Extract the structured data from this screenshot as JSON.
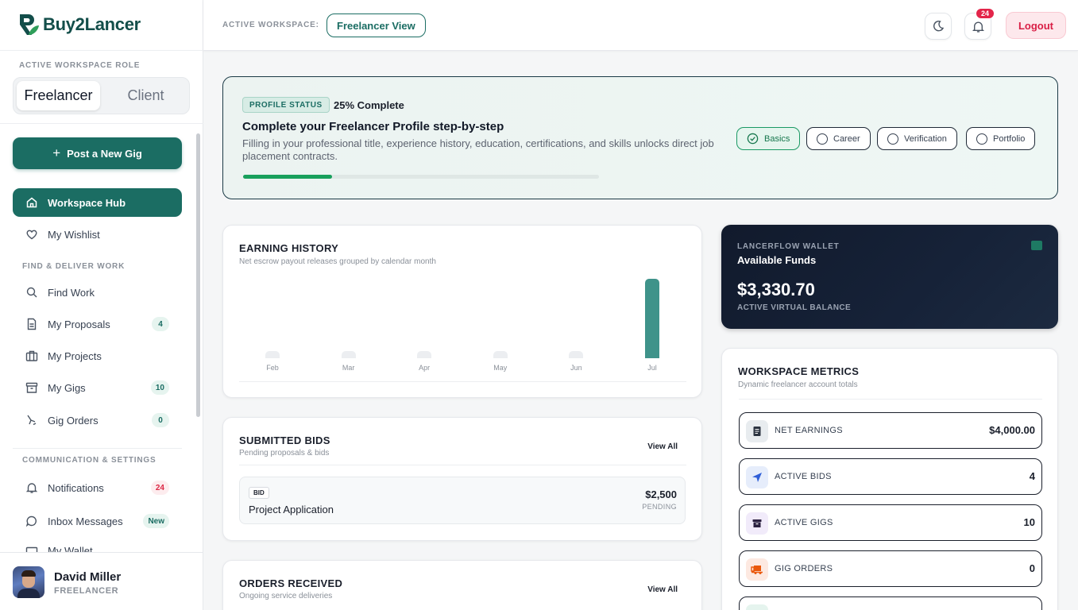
{
  "brand": {
    "name": "Buy2Lancer"
  },
  "sidebar": {
    "role_caption": "ACTIVE WORKSPACE ROLE",
    "roles": [
      "Freelancer",
      "Client"
    ],
    "post_gig_label": "Post a New Gig",
    "primary": [
      {
        "label": "Workspace Hub",
        "icon": "home-icon",
        "active": true
      },
      {
        "label": "My Wishlist",
        "icon": "heart-icon"
      }
    ],
    "section_find": "FIND & DELIVER WORK",
    "find_items": [
      {
        "label": "Find Work",
        "icon": "search-icon"
      },
      {
        "label": "My Proposals",
        "icon": "document-icon",
        "badge": "4"
      },
      {
        "label": "My Projects",
        "icon": "briefcase-icon"
      },
      {
        "label": "My Gigs",
        "icon": "archive-icon",
        "badge": "10"
      },
      {
        "label": "Gig Orders",
        "icon": "cart-icon",
        "badge": "0"
      }
    ],
    "section_comm": "COMMUNICATION & SETTINGS",
    "comm_items": [
      {
        "label": "Notifications",
        "icon": "bell-icon",
        "badge": "24"
      },
      {
        "label": "Inbox Messages",
        "icon": "chat-icon",
        "badge": "New"
      },
      {
        "label": "My Wallet",
        "icon": "wallet-icon"
      }
    ],
    "user": {
      "name": "David Miller",
      "role": "FREELANCER"
    }
  },
  "topbar": {
    "workspace_label": "ACTIVE WORKSPACE:",
    "workspace_value": "Freelancer View",
    "notification_count": "24",
    "logout_label": "Logout"
  },
  "profile": {
    "badge": "PROFILE STATUS",
    "complete": "25% Complete",
    "progress": 0.25,
    "title": "Complete your Freelancer Profile step-by-step",
    "description": "Filling in your professional title, experience history, education, certifications, and skills unlocks direct job placement contracts.",
    "steps": [
      "Basics",
      "Career",
      "Verification",
      "Portfolio"
    ]
  },
  "earning": {
    "title": "EARNING HISTORY",
    "subtitle": "Net escrow payout releases grouped by calendar month",
    "colors": {
      "bar": "#3f938a",
      "empty": "#eceef1"
    }
  },
  "chart_data": {
    "type": "bar",
    "categories": [
      "Feb",
      "Mar",
      "Apr",
      "May",
      "Jun",
      "Jul"
    ],
    "values": [
      0,
      0,
      0,
      0,
      0,
      1
    ],
    "title": "EARNING HISTORY",
    "xlabel": "",
    "ylabel": "",
    "grid": false
  },
  "bids": {
    "title": "SUBMITTED BIDS",
    "subtitle": "Pending proposals & bids",
    "view_all": "View All",
    "items": [
      {
        "tag": "BID",
        "title": "Project Application",
        "amount": "$2,500",
        "status": "PENDING"
      }
    ]
  },
  "orders": {
    "title": "ORDERS RECEIVED",
    "subtitle": "Ongoing service deliveries",
    "view_all": "View All"
  },
  "wallet": {
    "label": "LANCERFLOW WALLET",
    "title": "Available Funds",
    "amount": "$3,330.70",
    "sub": "ACTIVE VIRTUAL BALANCE"
  },
  "metrics": {
    "title": "WORKSPACE METRICS",
    "subtitle": "Dynamic freelancer account totals",
    "items": [
      {
        "label": "NET EARNINGS",
        "value": "$4,000.00",
        "icon": "ledger-icon",
        "color": "#e8ecef"
      },
      {
        "label": "ACTIVE BIDS",
        "value": "4",
        "icon": "send-icon",
        "color": "#e6edfb"
      },
      {
        "label": "ACTIVE GIGS",
        "value": "10",
        "icon": "store-icon",
        "color": "#f1ebfa"
      },
      {
        "label": "GIG ORDERS",
        "value": "0",
        "icon": "delivery-icon",
        "color": "#fde9e1"
      }
    ]
  }
}
